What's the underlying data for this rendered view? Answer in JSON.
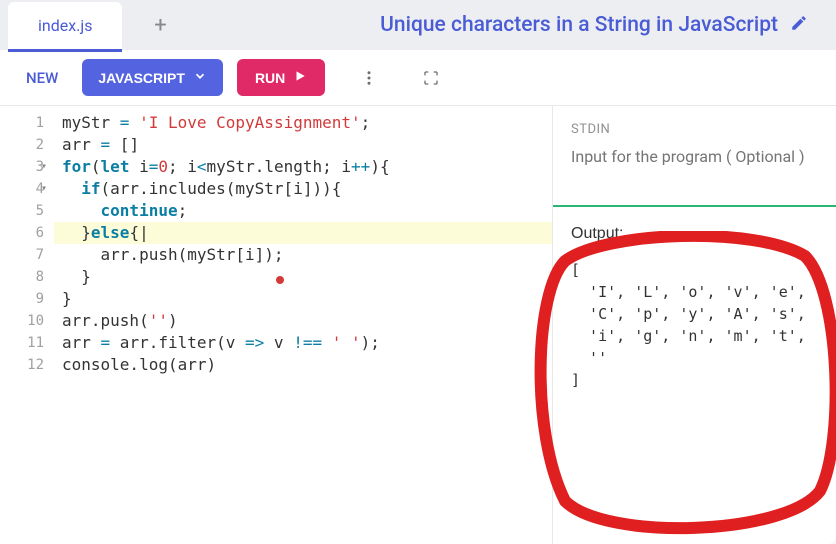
{
  "tab": {
    "filename": "index.js",
    "add_label": "+"
  },
  "page": {
    "title": "Unique characters in a String in JavaScript"
  },
  "toolbar": {
    "new_label": "NEW",
    "lang_label": "JAVASCRIPT",
    "run_label": "RUN"
  },
  "editor": {
    "lines": [
      {
        "n": "1",
        "html": "myStr <span class='op'>=</span> <span class='str'>'I Love CopyAssignment'</span>;"
      },
      {
        "n": "2",
        "html": "arr <span class='op'>=</span> []"
      },
      {
        "n": "3",
        "fold": true,
        "html": "<span class='kw'>for</span>(<span class='kw'>let</span> i<span class='op'>=</span><span class='num'>0</span>; i<span class='op'>&lt;</span>myStr.length; i<span class='op'>++</span>){"
      },
      {
        "n": "4",
        "fold": true,
        "html": "  <span class='kw'>if</span>(arr.includes(myStr[i])){"
      },
      {
        "n": "5",
        "html": "    <span class='kw'>continue</span>;"
      },
      {
        "n": "6",
        "highlight": true,
        "html": "  }<span class='kw'>else</span>{<span class='cursor'>|</span>"
      },
      {
        "n": "7",
        "html": "    arr.push(myStr[i]);"
      },
      {
        "n": "8",
        "html": "  }"
      },
      {
        "n": "9",
        "html": "}"
      },
      {
        "n": "10",
        "html": "arr.push(<span class='str'>''</span>)"
      },
      {
        "n": "11",
        "html": "arr <span class='op'>=</span> arr.filter(v <span class='op'>=&gt;</span> v <span class='op'>!==</span> <span class='str'>' '</span>);"
      },
      {
        "n": "12",
        "html": "console.log(arr)"
      }
    ]
  },
  "stdin": {
    "label": "STDIN",
    "placeholder": "Input for the program ( Optional )"
  },
  "output": {
    "label": "Output:",
    "content": "[\n  'I', 'L', 'o', 'v', 'e',\n  'C', 'p', 'y', 'A', 's',\n  'i', 'g', 'n', 'm', 't',\n  ''\n]"
  }
}
